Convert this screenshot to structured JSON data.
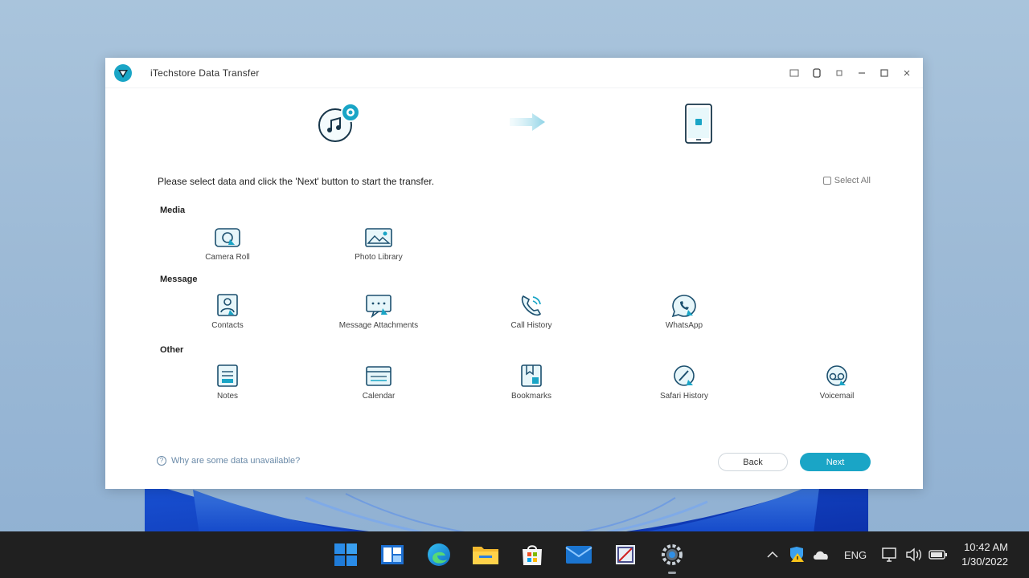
{
  "window": {
    "title": "iTechstore Data Transfer",
    "controls": [
      "feedback-icon",
      "settings-icon",
      "menu-icon",
      "minimize-icon",
      "maximize-icon",
      "close-icon"
    ]
  },
  "flow": {
    "source_icon": "itunes-music-icon",
    "arrow_icon": "arrow-right-icon",
    "target_icon": "phone-icon"
  },
  "instruction": "Please select data and click the 'Next' button to start the transfer.",
  "select_all": "Select All",
  "sections": [
    {
      "title": "Media",
      "items": [
        {
          "icon": "camera-roll-icon",
          "label": "Camera Roll"
        },
        {
          "icon": "photo-library-icon",
          "label": "Photo Library"
        }
      ]
    },
    {
      "title": "Message",
      "items": [
        {
          "icon": "contacts-icon",
          "label": "Contacts"
        },
        {
          "icon": "messages-icon",
          "label": "Message Attachments"
        },
        {
          "icon": "call-history-icon",
          "label": "Call History"
        },
        {
          "icon": "whatsapp-icon",
          "label": "WhatsApp"
        }
      ]
    },
    {
      "title": "Other",
      "items": [
        {
          "icon": "notes-icon",
          "label": "Notes"
        },
        {
          "icon": "calendar-icon",
          "label": "Calendar"
        },
        {
          "icon": "bookmark-icon",
          "label": "Bookmarks"
        },
        {
          "icon": "safari-history-icon",
          "label": "Safari History"
        },
        {
          "icon": "voicemail-icon",
          "label": "Voicemail"
        }
      ]
    }
  ],
  "footer_note": "Why are some data unavailable?",
  "buttons": {
    "back": "Back",
    "next": "Next"
  },
  "colors": {
    "accent": "#1aa5c6",
    "icon_stroke": "#1f7ea8",
    "taskbar": "#202020"
  },
  "taskbar": {
    "apps": [
      "windows-start-icon",
      "widgets-icon",
      "edge-icon",
      "file-explorer-icon",
      "store-icon",
      "mail-icon",
      "snipping-tool-icon",
      "settings-icon"
    ],
    "language": "ENG",
    "time": "10:42 AM",
    "date": "1/30/2022"
  }
}
